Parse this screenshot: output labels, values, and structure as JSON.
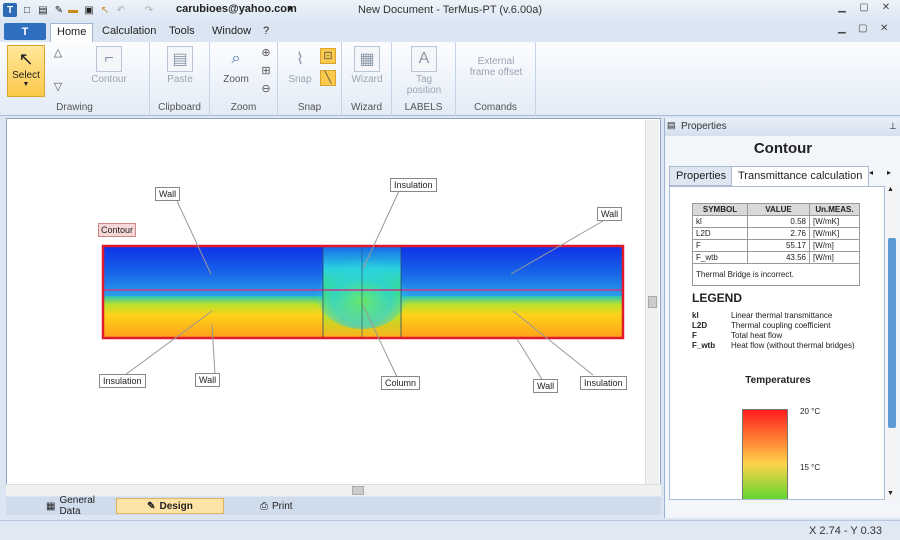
{
  "titlebar": {
    "user": "carubioes@yahoo.com",
    "title": "New Document - TerMus-PT (v.6.00a)"
  },
  "menu": {
    "file": "T",
    "tabs": [
      "Home",
      "Calculation",
      "Tools",
      "Window",
      "?"
    ]
  },
  "ribbon": {
    "select": "Select",
    "contour": "Contour",
    "paste": "Paste",
    "zoom": "Zoom",
    "snap": "Snap",
    "wizard": "Wizard",
    "tag": "Tag",
    "tag2": "position",
    "ext": "External",
    "ext2": "frame offset",
    "groups": {
      "drawing": "Drawing",
      "clipboard": "Clipboard",
      "zoom": "Zoom",
      "snap": "Snap",
      "wizard": "Wizard",
      "labels": "LABELS",
      "comands": "Comands"
    }
  },
  "canvas": {
    "labels": {
      "contour": "Contour",
      "wall_tl": "Wall",
      "insulation_top": "Insulation",
      "wall_tr": "Wall",
      "insulation_bl": "Insulation",
      "wall_bl": "Wall",
      "column": "Column",
      "wall_br": "Wall",
      "insulation_br": "Insulation"
    }
  },
  "bottom_tabs": {
    "general": "General Data",
    "design": "Design",
    "print": "Print"
  },
  "status": {
    "coords": "X 2.74 - Y 0.33"
  },
  "properties": {
    "header": "Properties",
    "title": "Contour",
    "tabs": [
      "Properties",
      "Transmittance calculation"
    ],
    "table": {
      "headers": [
        "SYMBOL",
        "VALUE",
        "Un.MEAS."
      ],
      "rows": [
        [
          "kl",
          "0.58",
          "[W/mK]"
        ],
        [
          "L2D",
          "2.76",
          "[W/mK]"
        ],
        [
          "F",
          "55.17",
          "[W/m]"
        ],
        [
          "F_wtb",
          "43.56",
          "[W/m]"
        ]
      ],
      "note": "Thermal Bridge is incorrect."
    },
    "legend_title": "LEGEND",
    "legend": [
      [
        "kl",
        "Linear thermal transmittance"
      ],
      [
        "L2D",
        "Thermal coupling coefficient"
      ],
      [
        "F",
        "Total heat flow"
      ],
      [
        "F_wtb",
        "Heat flow (without thermal bridges)"
      ]
    ],
    "temps_title": "Temperatures",
    "t20": "20 °C",
    "t15": "15 °C"
  },
  "colors": {
    "accent": "#2f6fc2",
    "selection": "#fbc94b",
    "contour": "#e0192b"
  }
}
